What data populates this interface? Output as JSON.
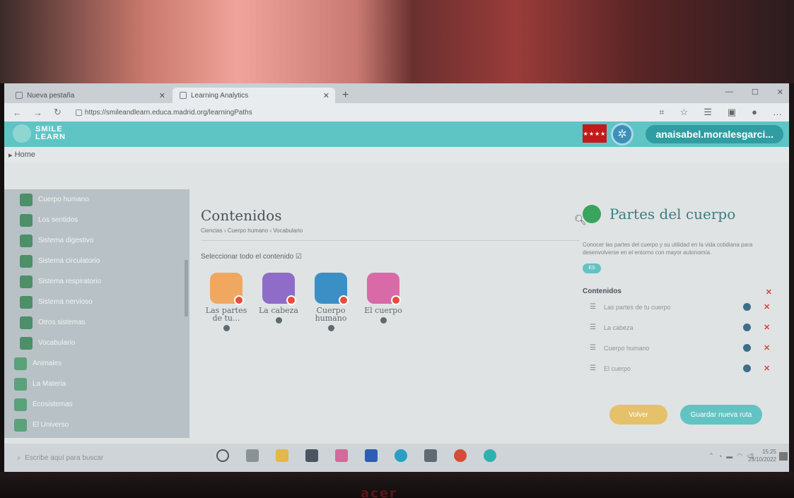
{
  "browser": {
    "tabs": [
      {
        "title": "Nueva pestaña",
        "active": false
      },
      {
        "title": "Learning Analytics",
        "active": true
      }
    ],
    "url": "https://smileandlearn.educa.madrid.org/learningPaths"
  },
  "app": {
    "logo_line1": "SMILE",
    "logo_line2": "LEARN",
    "user_name": "anaisabel.moralesgarci...",
    "breadcrumb": "Home"
  },
  "sidebar": {
    "items": [
      {
        "label": "Cuerpo humano",
        "level": "sub"
      },
      {
        "label": "Los sentidos",
        "level": "sub"
      },
      {
        "label": "Sistema digestivo",
        "level": "sub"
      },
      {
        "label": "Sistema circulatorio",
        "level": "sub"
      },
      {
        "label": "Sistema respiratorio",
        "level": "sub"
      },
      {
        "label": "Sistema nervioso",
        "level": "sub"
      },
      {
        "label": "Otros sistemas",
        "level": "sub"
      },
      {
        "label": "Vocabulario",
        "level": "sub"
      },
      {
        "label": "Animales",
        "level": "top"
      },
      {
        "label": "La Materia",
        "level": "top"
      },
      {
        "label": "Ecosistemas",
        "level": "top"
      },
      {
        "label": "El Universo",
        "level": "top"
      }
    ]
  },
  "content": {
    "title": "Contenidos",
    "breadcrumb": "Ciencias › Cuerpo humano › Vocabulario",
    "select_all": "Seleccionar todo el contenido",
    "cards": [
      {
        "label": "Las partes de tu...",
        "color": "#f0a860"
      },
      {
        "label": "La cabeza",
        "color": "#8e6cc8"
      },
      {
        "label": "Cuerpo humano",
        "color": "#3c8fc4"
      },
      {
        "label": "El cuerpo",
        "color": "#d86aa8"
      }
    ]
  },
  "panel": {
    "title": "Partes del cuerpo",
    "description": "Conocer las partes del cuerpo y su utilidad en la vida cotidiana para desenvolverse en el entorno con mayor autonomía.",
    "badge": "ES",
    "contents_label": "Contenidos",
    "items": [
      "Las partes de tu cuerpo",
      "La cabeza",
      "Cuerpo humano",
      "El cuerpo"
    ],
    "btn_back": "Volver",
    "btn_save": "Guardar nueva ruta"
  },
  "taskbar": {
    "search_placeholder": "Escribe aquí para buscar",
    "time": "15:25",
    "date": "23/10/2022"
  },
  "photo": {
    "brand": "acer"
  },
  "colors": {
    "header": "#5fc4c4",
    "accent": "#2f9da2",
    "delete": "#d9443c",
    "volver": "#e5c16a"
  }
}
